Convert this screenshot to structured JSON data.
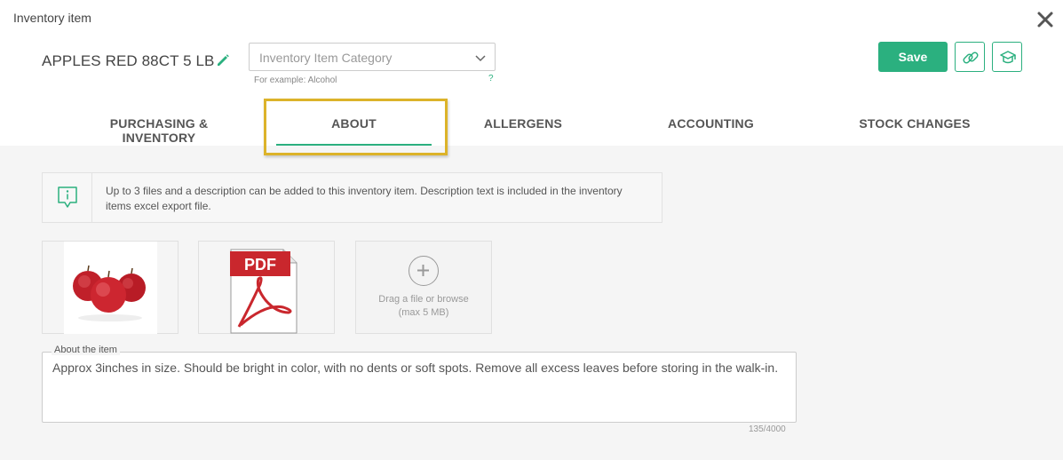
{
  "window": {
    "title": "Inventory item"
  },
  "item": {
    "name": "APPLES RED 88CT 5 LB"
  },
  "category": {
    "placeholder": "Inventory Item Category",
    "hint": "For example: Alcohol",
    "help": "?"
  },
  "toolbar": {
    "save_label": "Save"
  },
  "tabs": [
    {
      "label": "PURCHASING & INVENTORY",
      "active": false
    },
    {
      "label": "ABOUT",
      "active": true
    },
    {
      "label": "ALLERGENS",
      "active": false
    },
    {
      "label": "ACCOUNTING",
      "active": false
    },
    {
      "label": "STOCK CHANGES",
      "active": false
    }
  ],
  "info": {
    "text": "Up to 3 files and a description can be added to this inventory item. Description text is included in the inventory items excel export file."
  },
  "files": {
    "items": [
      {
        "type": "image",
        "icon": "apples-image"
      },
      {
        "type": "pdf",
        "icon": "pdf-icon",
        "badge": "PDF"
      }
    ],
    "upload_line1": "Drag a file or browse",
    "upload_line2": "(max 5 MB)"
  },
  "about": {
    "label": "About the item",
    "text": "Approx 3inches in size. Should be bright in color, with no dents or soft spots. Remove all excess leaves before storing in the walk-in.",
    "char_count": "135/4000"
  },
  "colors": {
    "accent": "#2bb07f",
    "highlight": "#dcb32a",
    "content_bg": "#f5f5f5"
  }
}
